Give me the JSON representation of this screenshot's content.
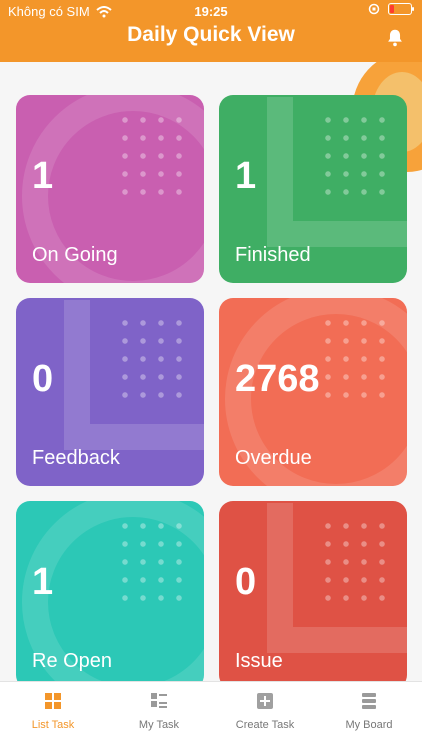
{
  "status_bar": {
    "carrier": "Không có SIM",
    "time": "19:25"
  },
  "header": {
    "title": "Daily Quick View"
  },
  "cards": [
    {
      "count": "1",
      "label": "On Going",
      "color": "#c95fb0"
    },
    {
      "count": "1",
      "label": "Finished",
      "color": "#3fae64"
    },
    {
      "count": "0",
      "label": "Feedback",
      "color": "#7f63c8"
    },
    {
      "count": "2768",
      "label": "Overdue",
      "color": "#f26d55"
    },
    {
      "count": "1",
      "label": "Re Open",
      "color": "#2cc8b6"
    },
    {
      "count": "0",
      "label": "Issue",
      "color": "#df5245"
    }
  ],
  "tabs": [
    {
      "label": "List Task",
      "icon": "grid-icon",
      "active": true
    },
    {
      "label": "My Task",
      "icon": "list-icon",
      "active": false
    },
    {
      "label": "Create Task",
      "icon": "plus-square-icon",
      "active": false
    },
    {
      "label": "My Board",
      "icon": "server-icon",
      "active": false
    }
  ],
  "colors": {
    "accent": "#f3962a"
  }
}
